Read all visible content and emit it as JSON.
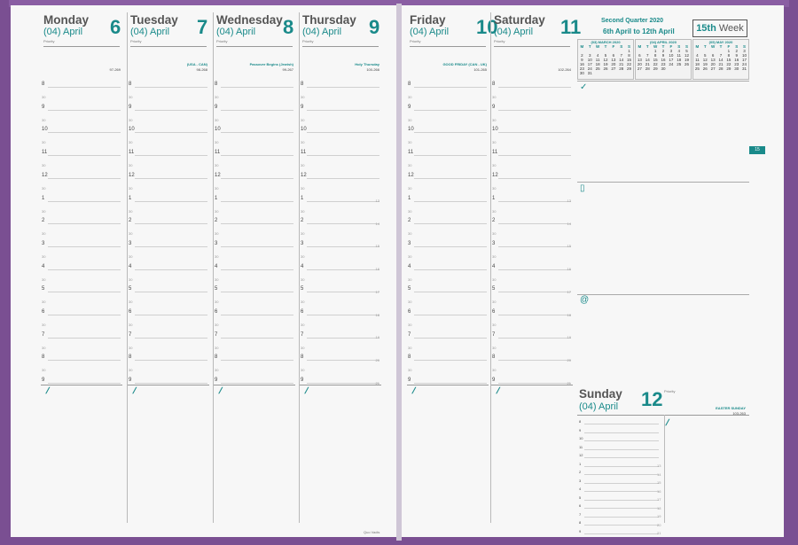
{
  "week": {
    "title": "15th",
    "suffix": "Week"
  },
  "quarter": {
    "title": "Second Quarter",
    "year": "2020",
    "range": "6th April to 12th April"
  },
  "priority_label": "Priority",
  "days": [
    {
      "name": "Monday",
      "month": "(04) April",
      "num": "6",
      "info": "97-269",
      "info2": ""
    },
    {
      "name": "Tuesday",
      "month": "(04) April",
      "num": "7",
      "info": "98-268",
      "info2": "(USA - CAN)"
    },
    {
      "name": "Wednesday",
      "month": "(04) April",
      "num": "8",
      "info": "99-267",
      "info2": "Passover Begins (Jewish)"
    },
    {
      "name": "Thursday",
      "month": "(04) April",
      "num": "9",
      "info": "100-266",
      "info2": "Holy Thursday"
    },
    {
      "name": "Friday",
      "month": "(04) April",
      "num": "10",
      "info": "101-265",
      "info2": "GOOD FRIDAY (CAN - UK)"
    },
    {
      "name": "Saturday",
      "month": "(04) April",
      "num": "11",
      "info": "102-264",
      "info2": ""
    }
  ],
  "sunday": {
    "name": "Sunday",
    "month": "(04) April",
    "num": "12",
    "info": "103-263",
    "info2": "EASTER SUNDAY"
  },
  "hours": [
    "8",
    "9",
    "10",
    "11",
    "12",
    "1",
    "2",
    "3",
    "4",
    "5",
    "6",
    "7",
    "8",
    "9"
  ],
  "side_nums": [
    "13",
    "14",
    "15",
    "16",
    "17",
    "18",
    "19",
    "20",
    "21"
  ],
  "sunday_hours": [
    "8",
    "9",
    "10",
    "11",
    "12",
    "1",
    "2",
    "3",
    "4",
    "5",
    "6",
    "7",
    "8",
    "9"
  ],
  "sunday_side": [
    "13",
    "14",
    "15",
    "16",
    "17",
    "18",
    "19",
    "20",
    "21"
  ],
  "minical": [
    {
      "title": "(03) MARCH 2020",
      "head": [
        "M",
        "T",
        "W",
        "T",
        "F",
        "S",
        "S"
      ],
      "days": [
        "",
        "",
        "",
        "",
        "",
        "",
        "1",
        "2",
        "3",
        "4",
        "5",
        "6",
        "7",
        "8",
        "9",
        "10",
        "11",
        "12",
        "13",
        "14",
        "15",
        "16",
        "17",
        "18",
        "19",
        "20",
        "21",
        "22",
        "23",
        "24",
        "25",
        "26",
        "27",
        "28",
        "29",
        "30",
        "31",
        "",
        "",
        "",
        ""
      ]
    },
    {
      "title": "(04) APRIL 2020",
      "head": [
        "M",
        "T",
        "W",
        "T",
        "F",
        "S",
        "S"
      ],
      "days": [
        "",
        "",
        "1",
        "2",
        "3",
        "4",
        "5",
        "6",
        "7",
        "8",
        "9",
        "10",
        "11",
        "12",
        "13",
        "14",
        "15",
        "16",
        "17",
        "18",
        "19",
        "20",
        "21",
        "22",
        "23",
        "24",
        "25",
        "26",
        "27",
        "28",
        "29",
        "30",
        "",
        "",
        ""
      ]
    },
    {
      "title": "(05) MAY 2020",
      "head": [
        "M",
        "T",
        "W",
        "T",
        "F",
        "S",
        "S"
      ],
      "days": [
        "",
        "",
        "",
        "",
        "1",
        "2",
        "3",
        "4",
        "5",
        "6",
        "7",
        "8",
        "9",
        "10",
        "11",
        "12",
        "13",
        "14",
        "15",
        "16",
        "17",
        "18",
        "19",
        "20",
        "21",
        "22",
        "23",
        "24",
        "25",
        "26",
        "27",
        "28",
        "29",
        "30",
        "31"
      ]
    }
  ],
  "tab_label": "15",
  "footer": "Quo Vadis",
  "colors": {
    "accent": "#1a8a8a",
    "cover": "#7a4f92"
  }
}
